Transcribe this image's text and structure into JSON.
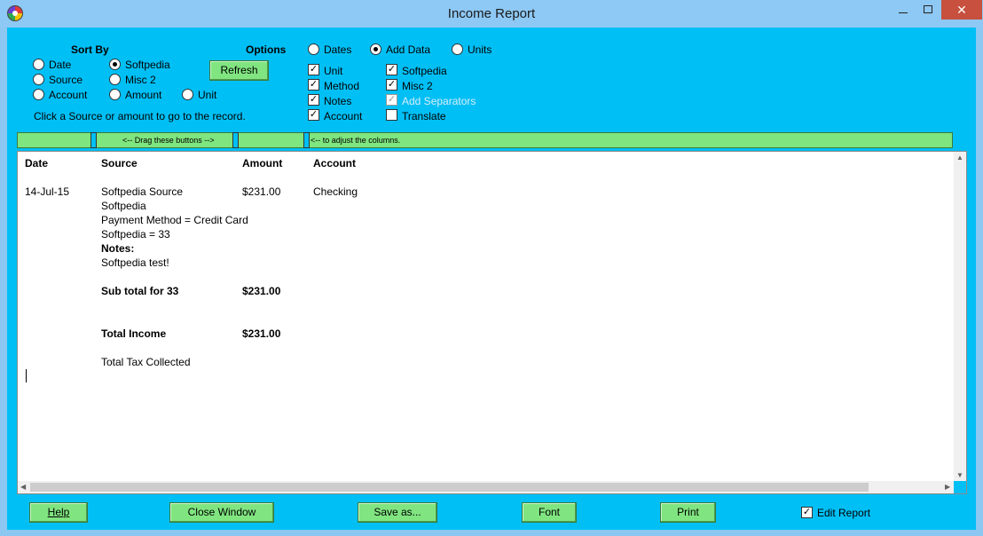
{
  "window": {
    "title": "Income Report",
    "minimize_label": "—",
    "maximize_label": "",
    "close_label": "✕",
    "app_icon": "app-icon"
  },
  "sort_by": {
    "heading": "Sort By",
    "options": [
      {
        "label": "Date",
        "selected": false
      },
      {
        "label": "Softpedia",
        "selected": true
      },
      {
        "label": "Source",
        "selected": false
      },
      {
        "label": "Misc 2",
        "selected": false
      },
      {
        "label": "Account",
        "selected": false
      },
      {
        "label": "Amount",
        "selected": false
      },
      {
        "label": "Unit",
        "selected": false
      }
    ],
    "hint": "Click a Source or amount to go to the record."
  },
  "refresh_label": "Refresh",
  "options": {
    "heading": "Options",
    "radios": [
      {
        "label": "Dates",
        "selected": false
      },
      {
        "label": "Add Data",
        "selected": true
      },
      {
        "label": "Units",
        "selected": false
      }
    ],
    "checks": [
      {
        "label": "Unit",
        "checked": true
      },
      {
        "label": "Softpedia",
        "checked": true
      },
      {
        "label": "Method",
        "checked": true
      },
      {
        "label": "Misc 2",
        "checked": true
      },
      {
        "label": "Notes",
        "checked": true
      },
      {
        "label": "Add Separators",
        "checked": true,
        "disabled": true
      },
      {
        "label": "Account",
        "checked": true
      },
      {
        "label": "Translate",
        "checked": false
      }
    ]
  },
  "drag_bar": {
    "text1": "<-- Drag these buttons -->",
    "text2": "<-- to adjust the columns."
  },
  "report": {
    "headers": {
      "date": "Date",
      "source": "Source",
      "amount": "Amount",
      "account": "Account"
    },
    "entry": {
      "date": "14-Jul-15",
      "source_lines": [
        "Softpedia Source",
        "Softpedia",
        "Payment Method = Credit Card",
        "Softpedia = 33"
      ],
      "notes_label": "Notes:",
      "notes_text": "Softpedia test!",
      "amount": "$231.00",
      "account": "Checking"
    },
    "subtotal": {
      "label": "Sub total for 33",
      "amount": "$231.00"
    },
    "total": {
      "label": "Total Income",
      "amount": "$231.00"
    },
    "tax": {
      "label": "Total Tax Collected"
    }
  },
  "footer": {
    "help": "Help",
    "close_window": "Close Window",
    "save_as": "Save as...",
    "font": "Font",
    "print": "Print",
    "edit_report": "Edit Report",
    "edit_report_checked": true
  }
}
